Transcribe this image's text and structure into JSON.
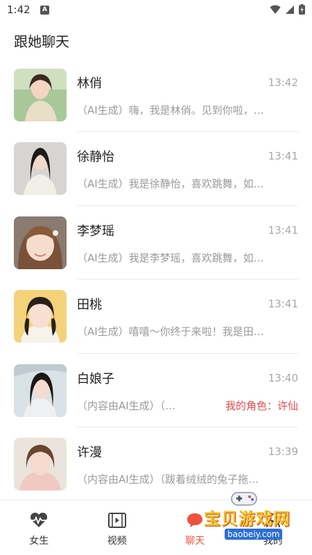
{
  "status_bar": {
    "time": "1:42",
    "notification_letter": "A"
  },
  "page": {
    "title": "跟她聊天"
  },
  "chats": [
    {
      "name": "林俏",
      "time": "13:42",
      "preview": "（AI生成）嗨，我是林俏。见到你啦，…",
      "role": ""
    },
    {
      "name": "徐静怡",
      "time": "13:41",
      "preview": "（AI生成）我是徐静怡，喜欢跳舞，如…",
      "role": ""
    },
    {
      "name": "李梦瑶",
      "time": "13:41",
      "preview": "（AI生成）我是李梦瑶，喜欢跳舞，如…",
      "role": ""
    },
    {
      "name": "田桃",
      "time": "13:41",
      "preview": "（AI生成）嘻嘻～你终于来啦！我是田…",
      "role": ""
    },
    {
      "name": "白娘子",
      "time": "13:40",
      "preview": "（内容由AI生成）（…",
      "role": "我的角色：许仙"
    },
    {
      "name": "许漫",
      "time": "13:39",
      "preview": "（内容由AI生成）（跋着绒绒的兔子拖…",
      "role": ""
    }
  ],
  "tabs": [
    {
      "label": "女生",
      "icon": "heartbeat-icon"
    },
    {
      "label": "视频",
      "icon": "film-icon"
    },
    {
      "label": "聊天",
      "icon": "chat-bubble-icon",
      "active": true
    },
    {
      "label": "我的",
      "icon": "user-icon"
    }
  ],
  "watermark": {
    "text": "宝贝游戏网",
    "url": "baobeiy.com"
  },
  "colors": {
    "accent": "#f0523d",
    "role": "#e84a4a",
    "muted": "#9a9a9a"
  }
}
